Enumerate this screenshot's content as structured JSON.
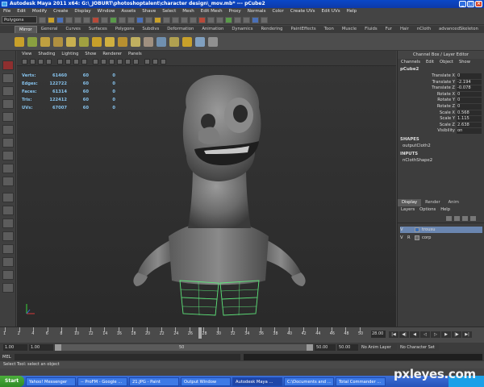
{
  "window": {
    "title": "Autodesk Maya 2011 x64: G:\\_JOBURT\\photoshoptalent\\character design\\_mov.mb* --- pCube2"
  },
  "menubar": {
    "items": [
      "File",
      "Edit",
      "Modify",
      "Create",
      "Display",
      "Window",
      "Assets",
      "Shave",
      "Select",
      "Mesh",
      "Edit Mesh",
      "Proxy",
      "Normals",
      "Color",
      "Create UVs",
      "Edit UVs",
      "Help"
    ]
  },
  "status_line": {
    "mode": "Polygons"
  },
  "shelf": {
    "tabs": [
      "Mirror",
      "General",
      "Curves",
      "Surfaces",
      "Polygons",
      "Subdivs",
      "Deformation",
      "Animation",
      "Dynamics",
      "Rendering",
      "PaintEffects",
      "Toon",
      "Muscle",
      "Fluids",
      "Fur",
      "Hair",
      "nCloth",
      "advancedSkeleton"
    ],
    "active_tab": "Mirror"
  },
  "viewport": {
    "menu": [
      "View",
      "Shading",
      "Lighting",
      "Show",
      "Renderer",
      "Panels"
    ],
    "hud": [
      {
        "label": "Verts:",
        "values": [
          "61460",
          "60",
          "0"
        ]
      },
      {
        "label": "Edges:",
        "values": [
          "122722",
          "60",
          "0"
        ]
      },
      {
        "label": "Faces:",
        "values": [
          "61314",
          "60",
          "0"
        ]
      },
      {
        "label": "Tris:",
        "values": [
          "122412",
          "60",
          "0"
        ]
      },
      {
        "label": "UVs:",
        "values": [
          "67007",
          "60",
          "0"
        ]
      }
    ]
  },
  "channel_box": {
    "title": "Channel Box / Layer Editor",
    "menu": [
      "Channels",
      "Edit",
      "Object",
      "Show"
    ],
    "node": "pCube2",
    "attributes": [
      {
        "name": "Translate X",
        "value": "0"
      },
      {
        "name": "Translate Y",
        "value": "-2.194"
      },
      {
        "name": "Translate Z",
        "value": "-0.078"
      },
      {
        "name": "Rotate X",
        "value": "0"
      },
      {
        "name": "Rotate Y",
        "value": "0"
      },
      {
        "name": "Rotate Z",
        "value": "0"
      },
      {
        "name": "Scale X",
        "value": "0.568"
      },
      {
        "name": "Scale Y",
        "value": "1.115"
      },
      {
        "name": "Scale Z",
        "value": "2.638"
      },
      {
        "name": "Visibility",
        "value": "on"
      }
    ],
    "shapes_header": "SHAPES",
    "shapes": [
      "outputCloth2"
    ],
    "inputs_header": "INPUTS",
    "inputs": [
      "nClothShape2"
    ]
  },
  "layer_editor": {
    "tabs": [
      "Display",
      "Render",
      "Anim"
    ],
    "active_tab": "Display",
    "menu": [
      "Layers",
      "Options",
      "Help"
    ],
    "layers": [
      {
        "v": "V",
        "t": "",
        "name": "trousu",
        "selected": true,
        "color": "#3a6fb8"
      },
      {
        "v": "V",
        "t": "R",
        "name": "corp",
        "selected": false,
        "color": "#6a6a6a"
      }
    ]
  },
  "time_slider": {
    "ticks": [
      "1",
      "2",
      "4",
      "6",
      "8",
      "10",
      "12",
      "14",
      "16",
      "18",
      "20",
      "22",
      "24",
      "26",
      "28",
      "30",
      "32",
      "34",
      "36",
      "38",
      "40",
      "42",
      "44",
      "46",
      "48",
      "50"
    ],
    "current_frame": "28.00"
  },
  "range_slider": {
    "start": "1.00",
    "inner_start": "1.00",
    "range_label": "50",
    "inner_end": "50.00",
    "end": "50.00",
    "anim_layer": "No Anim Layer",
    "character": "No Character Set"
  },
  "command_line": {
    "label": "MEL"
  },
  "help_line": {
    "text": "Select Tool: select an object"
  },
  "taskbar": {
    "start": "Start",
    "tasks": [
      "Yahoo! Messenger",
      "-- ProFM - Google ...",
      "21.JPG - Paint",
      "Output Window",
      "Autodesk Maya ...",
      "C:\\Documents and ...",
      "Total Commander ..."
    ],
    "active_index": 4
  },
  "watermark": "pxleyes.com"
}
